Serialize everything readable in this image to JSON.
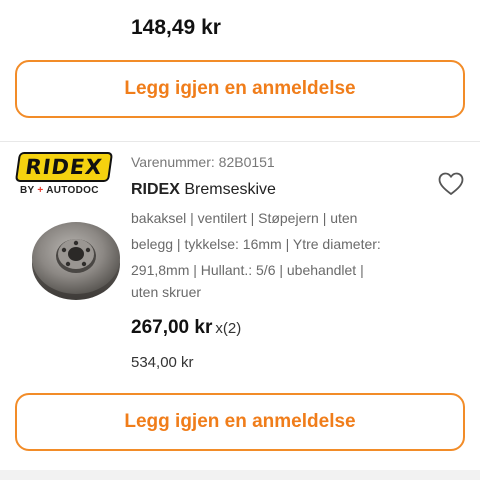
{
  "top_item": {
    "price": "148,49 kr"
  },
  "review_button_label": "Legg igjen en anmeldelse",
  "product": {
    "brand_logo_text": "RIDEX",
    "brand_byline_prefix": "BY",
    "brand_byline_plus": "+",
    "brand_byline_name": "AUTODOC",
    "article_number": "Varenummer: 82B0151",
    "brand": "RIDEX",
    "name": "Bremseskive",
    "spec_lines": [
      "bakaksel | ventilert | Støpejern | uten",
      "belegg | tykkelse: 16mm | Ytre diameter:",
      "291,8mm | Hullant.: 5/6 | ubehandlet |",
      "uten skruer"
    ],
    "unit_price": "267,00 kr",
    "quantity": "x(2)",
    "total_price": "534,00 kr",
    "favorite_icon": "heart-outline-icon",
    "image_icon": "brake-disc-image"
  },
  "colors": {
    "accent": "#f07d1a",
    "logo_yellow": "#f5d20f",
    "autodoc_red": "#e8372c"
  }
}
